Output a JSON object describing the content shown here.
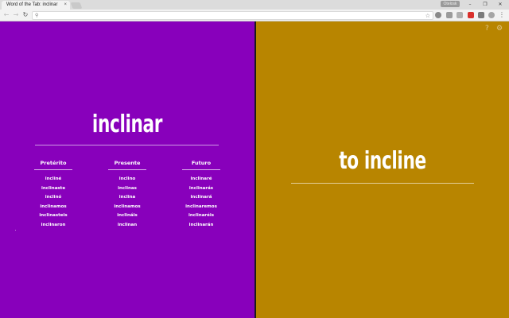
{
  "browser": {
    "tab_title": "Word of the Tab: inclinar",
    "tab_close": "×",
    "profile_label": "Otelosk",
    "minimize": "–",
    "restore": "❐",
    "close": "✕",
    "back": "←",
    "forward": "→",
    "reload": "↻",
    "search_glyph": "⚲",
    "star": "☆",
    "menu": "⋮",
    "url": ""
  },
  "colors": {
    "left_panel": "#8800bb",
    "right_panel": "#b88500",
    "divider": "#1a1a1a"
  },
  "word": {
    "spanish": "inclinar",
    "english": "to incline"
  },
  "conjugations": [
    {
      "tense": "Pretérito",
      "forms": [
        "incliné",
        "inclinaste",
        "inclinó",
        "inclinamos",
        "inclinasteis",
        "inclinaron"
      ]
    },
    {
      "tense": "Presente",
      "forms": [
        "inclino",
        "inclinas",
        "inclina",
        "inclinamos",
        "inclináis",
        "inclinan"
      ]
    },
    {
      "tense": "Futuro",
      "forms": [
        "inclinaré",
        "inclinarás",
        "inclinará",
        "inclinaremos",
        "inclinaréis",
        "inclinarán"
      ]
    }
  ],
  "icons": {
    "help": "?",
    "settings": "⚙"
  }
}
